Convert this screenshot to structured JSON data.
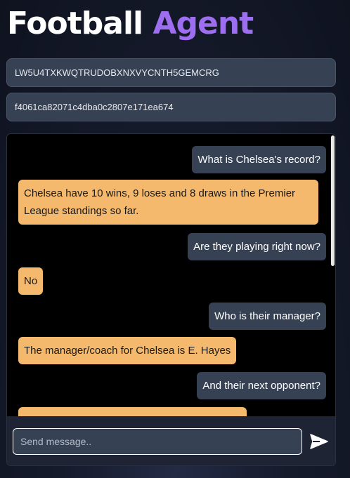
{
  "header": {
    "title_part1": "Football",
    "title_part2": "Agent"
  },
  "fields": {
    "api_key_value": "LW5U4TXKWQTRUDOBXNXVYCNTH5GEMCRG",
    "session_id_value": "f4061ca82071c4dba0c2807e171ea674"
  },
  "chat": {
    "messages": [
      {
        "role": "user",
        "text": "What is Chelsea's record?"
      },
      {
        "role": "bot",
        "text": "Chelsea have 10 wins, 9 loses and 8 draws in the Premier League standings so far."
      },
      {
        "role": "user",
        "text": "Are they playing right now?"
      },
      {
        "role": "bot",
        "text": "No"
      },
      {
        "role": "user",
        "text": "Who is their manager?"
      },
      {
        "role": "bot",
        "text": "The manager/coach for Chelsea is E. Hayes"
      },
      {
        "role": "user",
        "text": "And their next opponent?"
      },
      {
        "role": "bot",
        "text": ""
      }
    ]
  },
  "composer": {
    "placeholder": "Send message..",
    "send_icon": "send-arrow-icon"
  },
  "colors": {
    "accent": "#9d6ff0",
    "user_bubble": "#374154",
    "bot_bubble": "#f4b96d"
  }
}
